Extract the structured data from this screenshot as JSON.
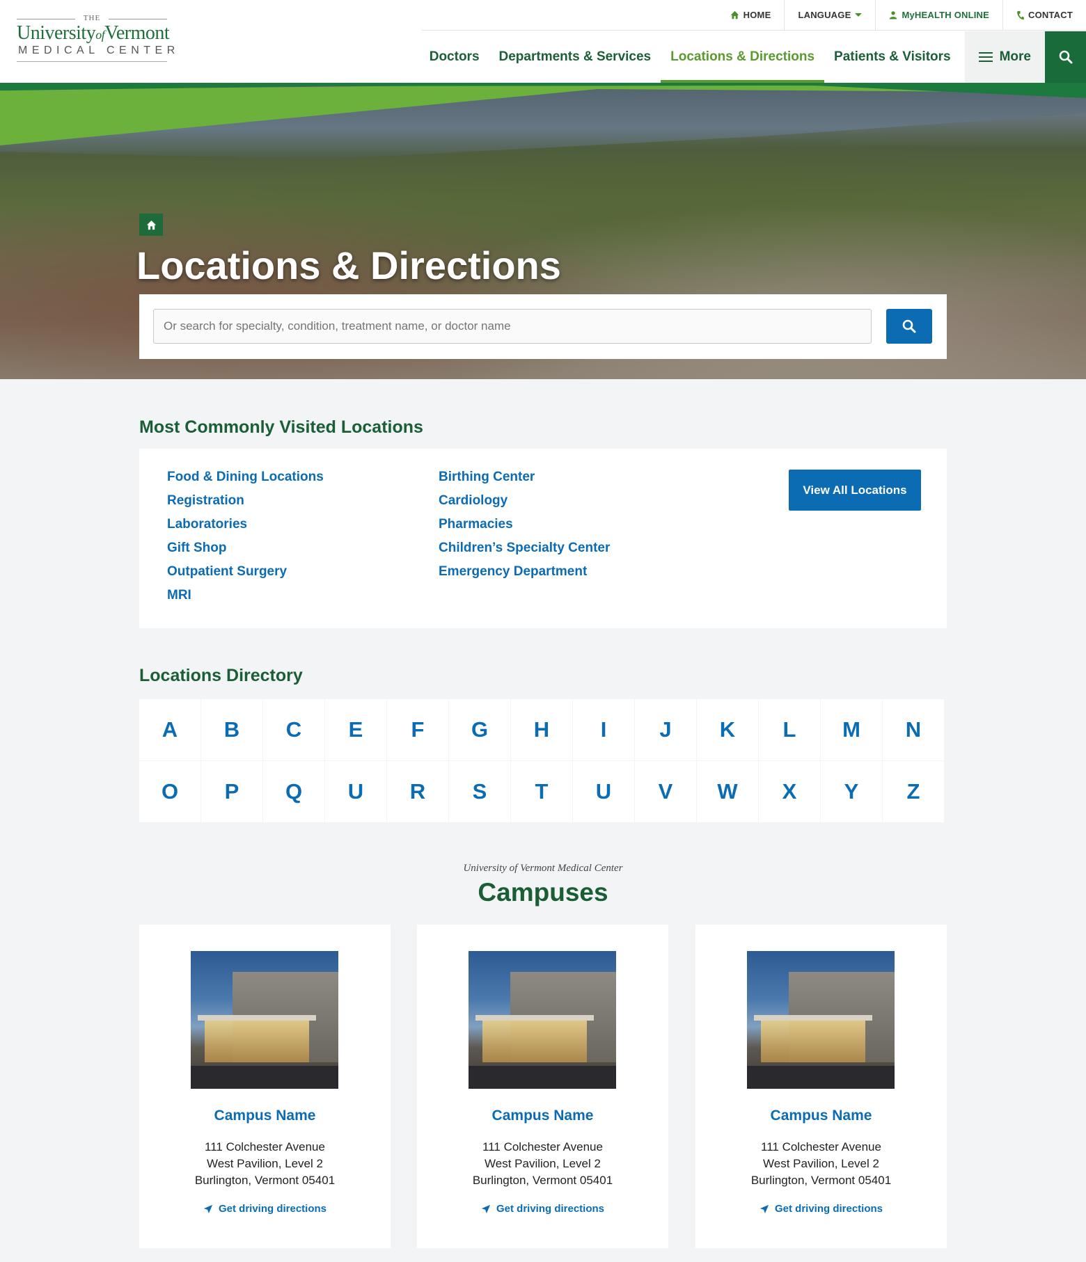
{
  "logo": {
    "the": "THE",
    "university": "University",
    "of": "of",
    "vermont": "Vermont",
    "medical_center": "MEDICAL CENTER"
  },
  "utility_nav": {
    "home": "HOME",
    "language": "LANGUAGE",
    "myhealth": "MyHEALTH ONLINE",
    "contact": "CONTACT"
  },
  "main_nav": {
    "doctors": "Doctors",
    "departments": "Departments & Services",
    "locations": "Locations & Directions",
    "patients": "Patients & Visitors",
    "more": "More"
  },
  "hero": {
    "title": "Locations & Directions",
    "search_placeholder": "Or search for specialty, condition, treatment name, or doctor name"
  },
  "common": {
    "heading": "Most Commonly Visited Locations",
    "col1": [
      "Food & Dining Locations",
      "Registration",
      "Laboratories",
      "Gift Shop",
      "Outpatient Surgery",
      "MRI"
    ],
    "col2": [
      "Birthing Center",
      "Cardiology",
      "Pharmacies",
      "Children’s Specialty Center",
      "Emergency Department"
    ],
    "view_all": "View All Locations"
  },
  "directory": {
    "heading": "Locations Directory",
    "letters": [
      "A",
      "B",
      "C",
      "E",
      "F",
      "G",
      "H",
      "I",
      "J",
      "K",
      "L",
      "M",
      "N",
      "O",
      "P",
      "Q",
      "U",
      "R",
      "S",
      "T",
      "U",
      "V",
      "W",
      "X",
      "Y",
      "Z"
    ]
  },
  "campuses": {
    "kicker": "University of Vermont Medical Center",
    "heading": "Campuses",
    "items": [
      {
        "name": "Campus Name",
        "line1": "111 Colchester Avenue",
        "line2": "West Pavilion, Level 2",
        "line3": "Burlington, Vermont 05401",
        "directions": "Get driving directions"
      },
      {
        "name": "Campus Name",
        "line1": "111 Colchester Avenue",
        "line2": "West Pavilion, Level 2",
        "line3": "Burlington, Vermont 05401",
        "directions": "Get driving directions"
      },
      {
        "name": "Campus Name",
        "line1": "111 Colchester Avenue",
        "line2": "West Pavilion, Level 2",
        "line3": "Burlington, Vermont 05401",
        "directions": "Get driving directions"
      }
    ]
  },
  "colors": {
    "brand_green": "#1a5e36",
    "accent_green": "#5a9a2e",
    "link_blue": "#0b6bb3"
  },
  "icons": [
    "home-icon",
    "caret-down-icon",
    "user-icon",
    "phone-icon",
    "menu-icon",
    "search-icon",
    "navigation-arrow-icon"
  ]
}
